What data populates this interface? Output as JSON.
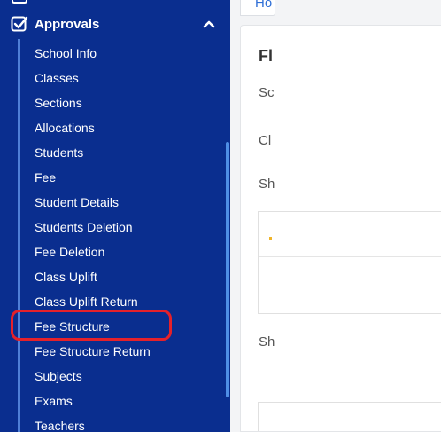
{
  "sidebar": {
    "group": {
      "title": "Approvals",
      "expanded": true
    },
    "items": [
      {
        "label": "School Info"
      },
      {
        "label": "Classes"
      },
      {
        "label": "Sections"
      },
      {
        "label": "Allocations"
      },
      {
        "label": "Students"
      },
      {
        "label": "Fee"
      },
      {
        "label": "Student Details"
      },
      {
        "label": "Students Deletion"
      },
      {
        "label": "Fee Deletion"
      },
      {
        "label": "Class Uplift"
      },
      {
        "label": "Class Uplift Return"
      },
      {
        "label": "Fee Structure"
      },
      {
        "label": "Fee Structure Return"
      },
      {
        "label": "Subjects"
      },
      {
        "label": "Exams"
      },
      {
        "label": "Teachers"
      }
    ],
    "highlighted_item": "Fee Structure"
  },
  "main": {
    "breadcrumb": "Ho",
    "card_title": "Fl",
    "labels": [
      "Sc",
      "Cl",
      "Sh",
      "Sh"
    ]
  },
  "colors": {
    "sidebar_bg": "#0a2e8f",
    "tree_line": "#4f7fd6",
    "highlight": "#e5212a",
    "link": "#2f6fd6",
    "main_bg": "#f3f4f6"
  },
  "icons": [
    "checkbox-checked-icon",
    "chevron-up-icon"
  ]
}
